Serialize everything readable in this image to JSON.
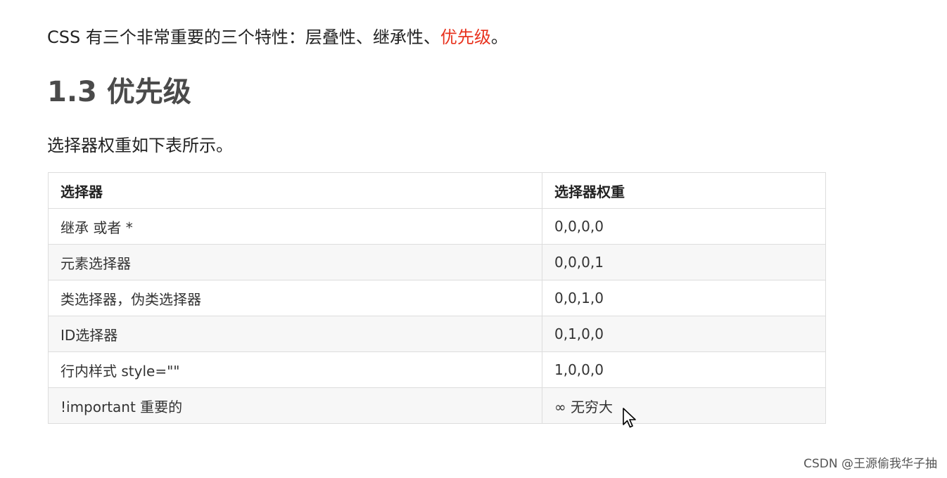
{
  "intro": {
    "prefix": "CSS 有三个非常重要的三个特性：层叠性、继承性、",
    "highlight": "优先级",
    "suffix": "。",
    "highlight_color": "#e8321e"
  },
  "heading": "1.3 优先级",
  "description": "选择器权重如下表所示。",
  "table": {
    "headers": [
      "选择器",
      "选择器权重"
    ],
    "rows": [
      {
        "selector": "继承 或者 *",
        "weight": "0,0,0,0"
      },
      {
        "selector": "元素选择器",
        "weight": "0,0,0,1"
      },
      {
        "selector": "类选择器，伪类选择器",
        "weight": "0,0,1,0"
      },
      {
        "selector": "ID选择器",
        "weight": "0,1,0,0"
      },
      {
        "selector": "行内样式 style=\"\"",
        "weight": "1,0,0,0"
      },
      {
        "selector": "!important  重要的",
        "weight": "∞ 无穷大"
      }
    ]
  },
  "cursor_icon": "mouse-pointer-icon",
  "watermark": "CSDN @王源偷我华子抽"
}
